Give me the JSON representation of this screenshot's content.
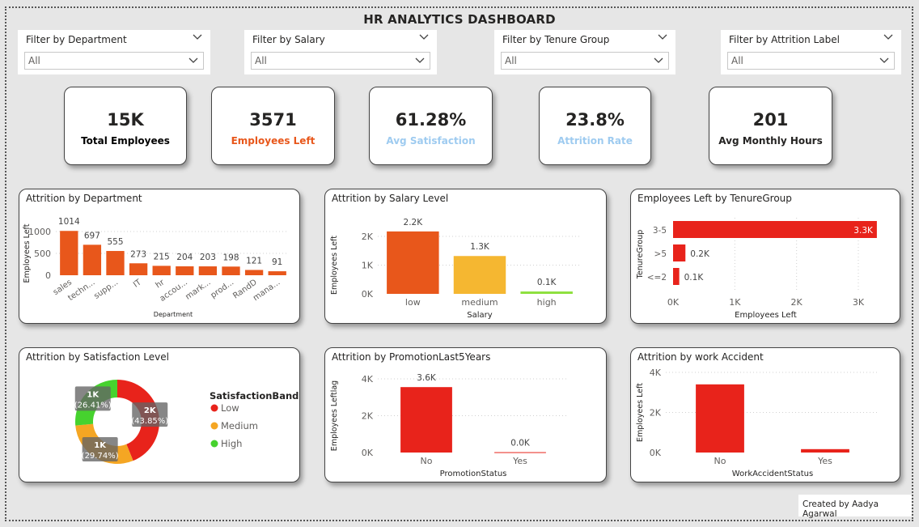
{
  "title": "HR ANALYTICS DASHBOARD",
  "filters": [
    {
      "label": "Filter by Department",
      "value": "All"
    },
    {
      "label": "Filter by Salary",
      "value": "All"
    },
    {
      "label": "Filter by Tenure Group",
      "value": "All"
    },
    {
      "label": "Filter by Attrition Label",
      "value": "All"
    }
  ],
  "kpis": [
    {
      "value": "15K",
      "label": "Total Employees",
      "color": "#000000"
    },
    {
      "value": "3571",
      "label": "Employees Left",
      "color": "#e8571b"
    },
    {
      "value": "61.28%",
      "label": "Avg Satisfaction",
      "color": "#9ecbf0"
    },
    {
      "value": "23.8%",
      "label": "Attrition Rate",
      "color": "#9ecbf0"
    },
    {
      "value": "201",
      "label": "Avg Monthly Hours",
      "color": "#252423"
    }
  ],
  "credit": "Created by Aadya Agarwal",
  "chart_data": [
    {
      "type": "bar",
      "title": "Attrition by Department",
      "xlabel": "Department",
      "ylabel": "Employees Left",
      "categories": [
        "sales",
        "techn...",
        "supp...",
        "IT",
        "hr",
        "accou...",
        "mark...",
        "prod...",
        "RandD",
        "mana..."
      ],
      "values": [
        1014,
        697,
        555,
        273,
        215,
        204,
        203,
        198,
        121,
        91
      ],
      "value_labels": [
        "1014",
        "697",
        "555",
        "273",
        "215",
        "204",
        "203",
        "198",
        "121",
        "91"
      ],
      "yticks": [
        "0",
        "500",
        "1000"
      ],
      "ylim": [
        0,
        1000
      ],
      "color": "#e8571b"
    },
    {
      "type": "bar",
      "title": "Attrition by Salary Level",
      "xlabel": "Salary",
      "ylabel": "Employees Left",
      "categories": [
        "low",
        "medium",
        "high"
      ],
      "values": [
        2172,
        1317,
        82
      ],
      "value_labels": [
        "2.2K",
        "1.3K",
        "0.1K"
      ],
      "colors": [
        "#e8571b",
        "#f5b731",
        "#8ce03b"
      ],
      "yticks": [
        "0K",
        "1K",
        "2K"
      ],
      "ylim": [
        0,
        2000
      ]
    },
    {
      "type": "bar",
      "orientation": "horizontal",
      "title": "Employees Left by TenureGroup",
      "xlabel": "Employees Left",
      "ylabel": "TenureGroup",
      "categories": [
        "3-5",
        ">5",
        "<=2"
      ],
      "values": [
        3300,
        200,
        100
      ],
      "value_labels": [
        "3.3K",
        "0.2K",
        "0.1K"
      ],
      "xticks": [
        "0K",
        "1K",
        "2K",
        "3K"
      ],
      "xlim": [
        0,
        3000
      ],
      "color": "#e8231b"
    },
    {
      "type": "pie",
      "title": "Attrition by Satisfaction Level",
      "legend_title": "SatisfactionBand",
      "legend_position": "right",
      "slices": [
        {
          "name": "Low",
          "value": 43.85,
          "label": "2K",
          "pct": "(43.85%)",
          "color": "#e8231b"
        },
        {
          "name": "Medium",
          "value": 29.74,
          "label": "1K",
          "pct": "(29.74%)",
          "color": "#f5a623"
        },
        {
          "name": "High",
          "value": 26.41,
          "label": "1K",
          "pct": "(26.41%)",
          "color": "#46d22e"
        }
      ]
    },
    {
      "type": "bar",
      "title": "Attrition by PromotionLast5Years",
      "xlabel": "PromotionStatus",
      "ylabel": "Employees Leftlag",
      "categories": [
        "No",
        "Yes"
      ],
      "values": [
        3552,
        19
      ],
      "value_labels": [
        "3.6K",
        "0.0K"
      ],
      "yticks": [
        "0K",
        "2K",
        "4K"
      ],
      "ylim": [
        0,
        4000
      ],
      "color": "#e8231b"
    },
    {
      "type": "bar",
      "title": "Attrition by work Accident",
      "xlabel": "WorkAccidentStatus",
      "ylabel": "Employees Left",
      "categories": [
        "No",
        "Yes"
      ],
      "values": [
        3402,
        169
      ],
      "yticks": [
        "0K",
        "2K",
        "4K"
      ],
      "ylim": [
        0,
        4000
      ],
      "color": "#e8231b"
    }
  ]
}
